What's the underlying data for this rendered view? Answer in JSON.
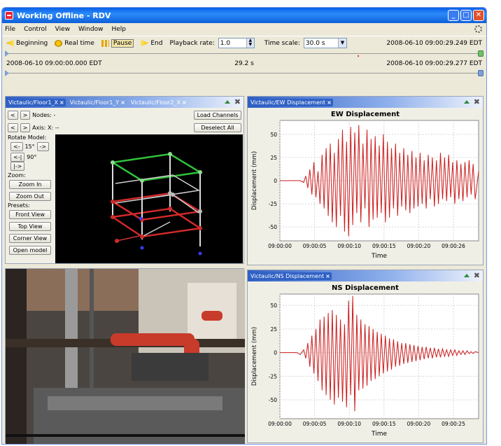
{
  "window": {
    "title": "Working Offline - RDV"
  },
  "menu": [
    "File",
    "Control",
    "View",
    "Window",
    "Help"
  ],
  "toolbar": {
    "beginning": "Beginning",
    "real_time": "Real time",
    "pause": "Pause",
    "end": "End",
    "playback_rate_label": "Playback rate:",
    "playback_rate_value": "1.0",
    "time_scale_label": "Time scale:",
    "time_scale_value": "30.0 s",
    "end_timestamp": "2008-06-10 09:00:29.249 EDT"
  },
  "timeline": {
    "start": "2008-06-10 09:00:00.000 EDT",
    "center": "29.2 s",
    "end": "2008-06-10 09:00:29.277 EDT",
    "position": 0.74
  },
  "model_panel": {
    "tabs": [
      "Victaulic/Floor1_X",
      "Victaulic/Floor1_Y",
      "Victaulic/Floor2_X"
    ],
    "prev": "<",
    "next": ">",
    "nodes_label": "Nodes: -",
    "axis_label": "Axis:  X: --",
    "load_channels": "Load Channels",
    "deselect_all": "Deselect All",
    "rotate_label": "Rotate Model:",
    "rot_left": "<-",
    "rot_15": "15°",
    "rot_right": "->",
    "rot_left2": "<-|",
    "rot_90": "90°",
    "rot_right2": "|->",
    "zoom_label": "Zoom:",
    "zoom_in": "Zoom In",
    "zoom_out": "Zoom Out",
    "presets_label": "Presets:",
    "front_view": "Front View",
    "top_view": "Top View",
    "corner_view": "Corner View",
    "open_model": "Open model"
  },
  "ew_panel": {
    "tab": "Victaulic/EW Displacement"
  },
  "ns_panel": {
    "tab": "Victaulic/NS Displacement"
  },
  "chart_data": [
    {
      "type": "line",
      "title": "EW Displacement",
      "xlabel": "Time",
      "ylabel": "Displacement (mm)",
      "xticks": [
        "09:00:00",
        "09:00:05",
        "09:00:10",
        "09:00:15",
        "09:00:20",
        "09:00:26"
      ],
      "yticks": [
        -50,
        -25,
        0,
        25,
        50
      ],
      "ylim": [
        -65,
        65
      ],
      "xlim": [
        0,
        29.2
      ],
      "color": "#cc1a1a",
      "series": [
        {
          "x": [
            0,
            2,
            3,
            3.5,
            3.8,
            4.1,
            4.4,
            4.7,
            5,
            5.3,
            5.6,
            5.9,
            6.2,
            6.5,
            6.8,
            7.1,
            7.4,
            7.7,
            8,
            8.3,
            8.6,
            8.9,
            9.2,
            9.5,
            9.8,
            10.1,
            10.4,
            10.7,
            11,
            11.3,
            11.6,
            11.9,
            12.2,
            12.5,
            12.8,
            13.1,
            13.4,
            13.7,
            14,
            14.3,
            14.6,
            14.9,
            15.2,
            15.5,
            15.8,
            16.1,
            16.4,
            16.7,
            17,
            17.3,
            17.6,
            17.9,
            18.2,
            18.5,
            18.8,
            19.1,
            19.4,
            19.7,
            20,
            20.3,
            20.6,
            20.9,
            21.2,
            21.5,
            21.8,
            22.1,
            22.4,
            22.7,
            23,
            23.3,
            23.6,
            23.9,
            24.2,
            24.5,
            24.8,
            25.1,
            25.4,
            25.7,
            26,
            26.3,
            26.6,
            26.9,
            27.2,
            27.5,
            27.8,
            28.1,
            28.4,
            28.7,
            29.2
          ],
          "y": [
            0,
            0,
            0,
            -2,
            5,
            -8,
            12,
            -15,
            20,
            -18,
            10,
            -25,
            28,
            -30,
            35,
            -38,
            40,
            -45,
            30,
            -50,
            45,
            -38,
            55,
            -55,
            42,
            -60,
            58,
            -48,
            52,
            -35,
            60,
            -45,
            40,
            -30,
            55,
            -50,
            45,
            -42,
            48,
            -40,
            38,
            -35,
            50,
            -45,
            42,
            -40,
            35,
            -30,
            40,
            -38,
            30,
            -28,
            35,
            -32,
            28,
            -35,
            32,
            -30,
            25,
            -28,
            30,
            -25,
            22,
            -30,
            28,
            -20,
            25,
            -28,
            22,
            -25,
            30,
            -20,
            25,
            -22,
            28,
            -18,
            20,
            -25,
            22,
            -20,
            18,
            -22,
            20,
            -18,
            22,
            -15,
            18,
            -20,
            10
          ]
        }
      ]
    },
    {
      "type": "line",
      "title": "NS Displacement",
      "xlabel": "Time",
      "ylabel": "Displacement (mm)",
      "xticks": [
        "09:00:00",
        "09:00:05",
        "09:00:10",
        "09:00:15",
        "09:00:20",
        "09:00:25"
      ],
      "yticks": [
        -50,
        -25,
        0,
        25,
        50
      ],
      "ylim": [
        -70,
        62
      ],
      "xlim": [
        0,
        29.2
      ],
      "color": "#cc1a1a",
      "series": [
        {
          "x": [
            0,
            2.5,
            3,
            3.5,
            3.8,
            4.1,
            4.4,
            4.7,
            5,
            5.3,
            5.6,
            5.9,
            6.2,
            6.5,
            6.8,
            7.1,
            7.4,
            7.7,
            8,
            8.3,
            8.6,
            8.9,
            9.2,
            9.5,
            9.8,
            10.1,
            10.4,
            10.7,
            11,
            11.3,
            11.6,
            11.9,
            12.2,
            12.5,
            12.8,
            13.1,
            13.4,
            13.7,
            14,
            14.3,
            14.6,
            14.9,
            15.2,
            15.5,
            15.8,
            16.1,
            16.4,
            16.7,
            17,
            17.3,
            17.6,
            17.9,
            18.2,
            18.5,
            18.8,
            19.1,
            19.4,
            19.7,
            20,
            20.3,
            20.6,
            20.9,
            21.2,
            21.5,
            21.8,
            22.1,
            22.4,
            22.7,
            23,
            23.3,
            23.6,
            23.9,
            24.2,
            24.5,
            24.8,
            25.1,
            25.4,
            25.7,
            26,
            26.3,
            26.6,
            26.9,
            27.2,
            27.5,
            27.8,
            28.1,
            28.4,
            28.7,
            29.2
          ],
          "y": [
            0,
            0,
            -2,
            3,
            -6,
            10,
            -15,
            18,
            -22,
            25,
            -30,
            35,
            -40,
            38,
            -45,
            42,
            -50,
            45,
            -55,
            40,
            -48,
            35,
            -52,
            30,
            -58,
            55,
            -45,
            60,
            -62,
            40,
            -40,
            35,
            -38,
            30,
            -35,
            28,
            -30,
            25,
            -28,
            22,
            -25,
            20,
            -22,
            18,
            -20,
            15,
            -18,
            14,
            -15,
            12,
            -14,
            10,
            -12,
            10,
            -11,
            9,
            -10,
            8,
            -9,
            7,
            -8,
            6,
            -7,
            6,
            -6,
            5,
            -6,
            5,
            -5,
            4,
            -5,
            4,
            -4,
            3,
            -4,
            3,
            -3,
            3,
            -3,
            2,
            -2,
            2,
            -2,
            2,
            -1,
            1,
            -1,
            1,
            0
          ]
        }
      ]
    }
  ]
}
